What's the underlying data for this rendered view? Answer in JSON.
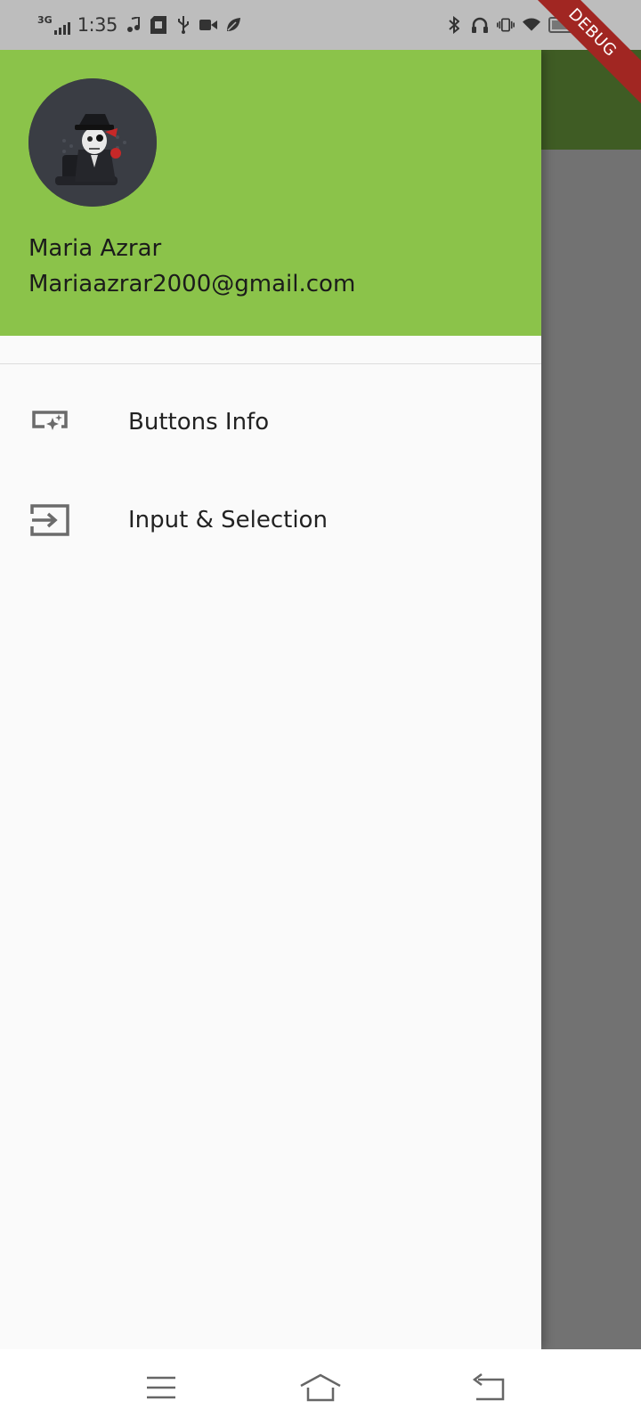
{
  "status_bar": {
    "network": "3G",
    "time": "1:35",
    "icons_left": [
      "music-note-icon",
      "sd-card-icon",
      "usb-icon",
      "video-icon",
      "leaf-icon"
    ],
    "icons_right": [
      "bluetooth-icon",
      "headphones-icon",
      "vibrate-icon",
      "wifi-icon",
      "battery-icon"
    ]
  },
  "debug_banner": "DEBUG",
  "drawer": {
    "header_color": "#8bc34a",
    "user": {
      "name": "Maria Azrar",
      "email": "Mariaazrar2000@gmail.com"
    },
    "items": [
      {
        "label": "Buttons Info",
        "icon": "button-info-icon"
      },
      {
        "label": "Input & Selection",
        "icon": "input-icon"
      }
    ]
  },
  "nav_bar": {
    "buttons": [
      "menu-icon",
      "home-icon",
      "back-icon"
    ]
  },
  "colors": {
    "accent": "#8bc34a",
    "app_bar_dimmed": "#3f5c24",
    "scrim": "#727272",
    "debug": "#a12622"
  }
}
